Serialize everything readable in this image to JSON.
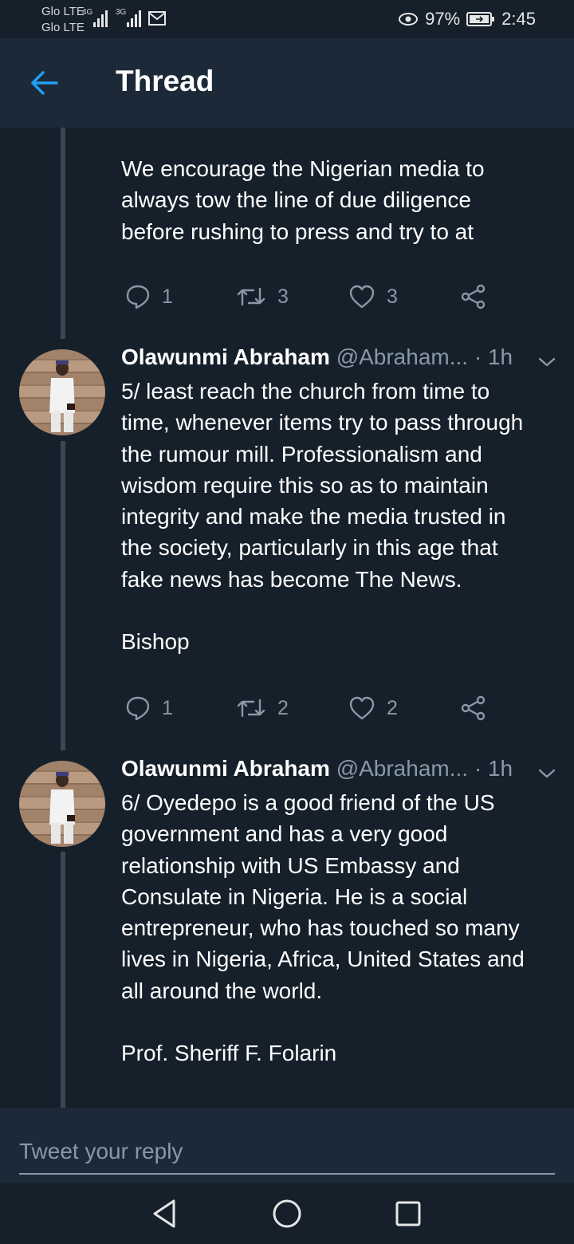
{
  "status_bar": {
    "carrier_1": "Glo LTE",
    "carrier_2": "Glo LTE",
    "net_1": "4G",
    "net_2": "3G",
    "battery": "97%",
    "time": "2:45"
  },
  "header": {
    "title": "Thread"
  },
  "tweets": [
    {
      "text": "We encourage the Nigerian media to\nalways tow the line of due diligence\nbefore rushing to press and try to at",
      "replies": "1",
      "retweets": "3",
      "likes": "3"
    },
    {
      "name": "Olawunmi Abraham",
      "handle": "@Abraham...",
      "time": "· 1h",
      "text": "5/ least reach the church from time to\ntime, whenever items try to pass through\nthe rumour mill. Professionalism and\nwisdom require this so as to maintain\nintegrity and make the media trusted in\nthe society, particularly in this age that\nfake news has become The News.\n\nBishop",
      "replies": "1",
      "retweets": "2",
      "likes": "2"
    },
    {
      "name": "Olawunmi Abraham",
      "handle": "@Abraham...",
      "time": "· 1h",
      "text": "6/ Oyedepo is a good friend of the US\ngovernment and has a very good\nrelationship with US Embassy and\nConsulate in Nigeria. He is a social\nentrepreneur, who has touched so many\nlives in Nigeria, Africa, United States and\nall around the world.\n\nProf. Sheriff F. Folarin"
    }
  ],
  "reply": {
    "placeholder": "Tweet your reply"
  },
  "colors": {
    "background": "#15202b",
    "bar": "#1c2938",
    "accent": "#1da1f2",
    "muted": "#8899a6"
  },
  "icons": [
    "back-arrow-icon",
    "reply-icon",
    "retweet-icon",
    "like-icon",
    "share-icon",
    "chevron-down-icon",
    "nav-back-icon",
    "nav-home-icon",
    "nav-recents-icon",
    "eye-icon",
    "battery-icon",
    "mail-icon",
    "signal-icon"
  ]
}
